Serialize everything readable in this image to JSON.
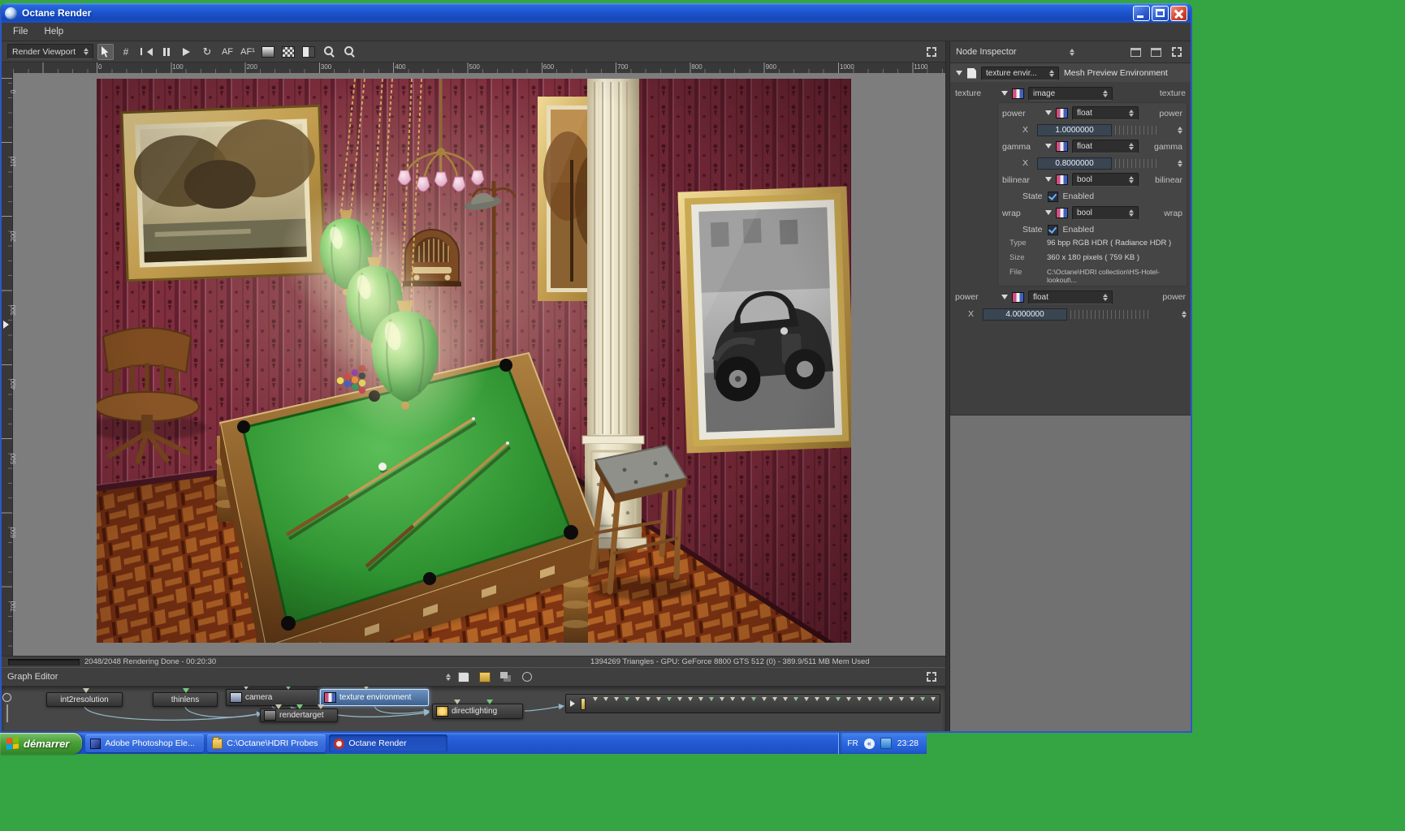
{
  "window": {
    "title": "Octane Render"
  },
  "menu": {
    "file": "File",
    "help": "Help"
  },
  "toolbar": {
    "viewport": "Render Viewport",
    "af": "AF",
    "af1": "AF¹"
  },
  "ruler": {
    "h": [
      "0",
      "100",
      "200",
      "300",
      "400",
      "500",
      "600",
      "700",
      "800",
      "900",
      "1000",
      "1100"
    ],
    "v": [
      "0",
      "100",
      "200",
      "300",
      "400",
      "500",
      "600",
      "700"
    ]
  },
  "status": {
    "progress": "2048/2048 Rendering Done - 00:20:30",
    "stats": "1394269 Triangles - GPU: GeForce 8800 GTS 512 (0) - 389.9/511 MB Mem Used"
  },
  "inspector": {
    "title": "Node Inspector",
    "node_type": "texture envir...",
    "node_name": "Mesh Preview Environment",
    "texture": {
      "label": "texture",
      "type": "image",
      "pin": "texture"
    },
    "power": {
      "label": "power",
      "type": "float",
      "pin": "power",
      "param": "X",
      "value": "1.0000000"
    },
    "gamma": {
      "label": "gamma",
      "type": "float",
      "pin": "gamma",
      "param": "X",
      "value": "0.8000000"
    },
    "bilinear": {
      "label": "bilinear",
      "type": "bool",
      "pin": "bilinear",
      "state_label": "State",
      "state": "Enabled"
    },
    "wrap": {
      "label": "wrap",
      "type": "bool",
      "pin": "wrap",
      "state_label": "State",
      "state": "Enabled"
    },
    "meta": {
      "type_label": "Type",
      "type": "96 bpp RGB HDR ( Radiance HDR )",
      "size_label": "Size",
      "size": "360 x 180 pixels ( 759 KB )",
      "file_label": "File",
      "file": "C:\\Octane\\HDRI collection\\HS-Hotel-lookout\\..."
    },
    "power2": {
      "label": "power",
      "type": "float",
      "pin": "power",
      "param": "X",
      "value": "4.0000000"
    }
  },
  "graph": {
    "title": "Graph Editor",
    "pin_count": 33,
    "nodes": [
      {
        "label": "int2resolution"
      },
      {
        "label": "thinlens"
      },
      {
        "label": "camera"
      },
      {
        "label": "texture environment"
      },
      {
        "label": "rendertarget"
      },
      {
        "label": "directlighting"
      }
    ]
  },
  "taskbar": {
    "start": "démarrer",
    "tasks": [
      "Adobe Photoshop Ele...",
      "C:\\Octane\\HDRI Probes",
      "Octane Render"
    ],
    "tray": {
      "lang": "FR",
      "time": "23:28"
    }
  }
}
